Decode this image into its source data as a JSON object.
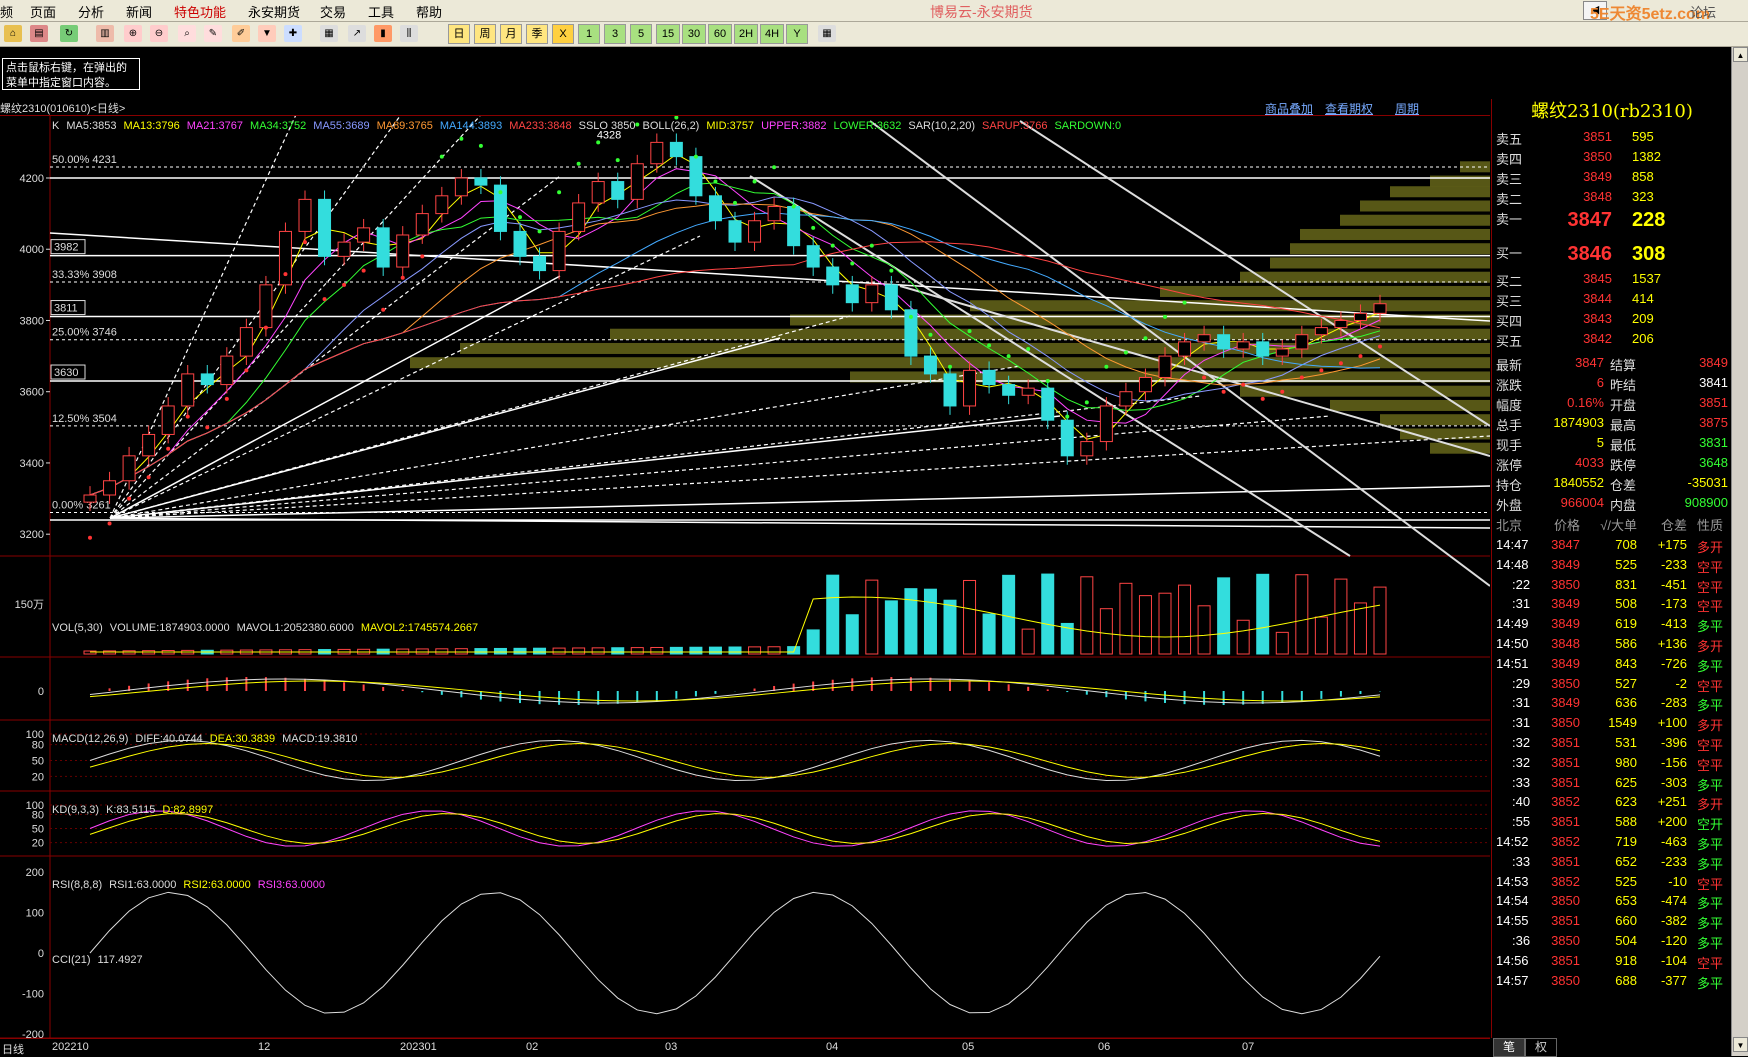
{
  "menu": {
    "items": [
      "频",
      "页面",
      "分析",
      "新闻",
      "特色功能",
      "永安期货",
      "交易",
      "工具",
      "帮助"
    ],
    "title": "博易云-永安期货",
    "watermark": "5E天资5etz.com",
    "forum": "论坛"
  },
  "toolbar": {
    "period_buttons": [
      "日",
      "周",
      "月",
      "季",
      "X",
      "1",
      "3",
      "5",
      "15",
      "30",
      "60",
      "2H",
      "4H",
      "Y"
    ]
  },
  "tip": {
    "line1": "点击鼠标右键，在弹出的",
    "line2": "菜单中指定窗口内容。"
  },
  "chart_header": {
    "instrument": "螺纹2310(010610)<日线>",
    "links": [
      "商品叠加",
      "查看期权",
      "周期"
    ]
  },
  "main_legend": [
    {
      "text": "K",
      "color": "#dddddd"
    },
    {
      "text": "MA5:3853",
      "color": "#dddddd"
    },
    {
      "text": "MA13:3796",
      "color": "#ffff00"
    },
    {
      "text": "MA21:3767",
      "color": "#ff44ff"
    },
    {
      "text": "MA34:3752",
      "color": "#33ff33"
    },
    {
      "text": "MA55:3689",
      "color": "#8899ff"
    },
    {
      "text": "MA89:3765",
      "color": "#ff9933"
    },
    {
      "text": "MA144:3893",
      "color": "#44aaff"
    },
    {
      "text": "MA233:3848",
      "color": "#ff4444"
    },
    {
      "text": "SSLO 3850",
      "color": "#dddddd"
    },
    {
      "text": "BOLL(26,2)",
      "color": "#dddddd"
    },
    {
      "text": "MID:3757",
      "color": "#ffff00"
    },
    {
      "text": "UPPER:3882",
      "color": "#ff44ff"
    },
    {
      "text": "LOWER:3632",
      "color": "#33ff33"
    },
    {
      "text": "SAR(10,2,20)",
      "color": "#dddddd"
    },
    {
      "text": "SARUP:3766",
      "color": "#ff4444"
    },
    {
      "text": "SARDOWN:0",
      "color": "#33ff33"
    }
  ],
  "price_axis": [
    "4200",
    "4000",
    "3800",
    "3600",
    "3400",
    "3200"
  ],
  "fib_labels": [
    "50.00%  4231",
    "33.33%  3908",
    "25.00%  3746",
    "12.50%  3504",
    "0.00%  3261"
  ],
  "boxed_levels": [
    "3982",
    "3811",
    "3630"
  ],
  "peak_label": "4328",
  "vol": {
    "legend": [
      {
        "text": "VOL(5,30)",
        "color": "#dddddd"
      },
      {
        "text": "VOLUME:1874903.0000",
        "color": "#dddddd"
      },
      {
        "text": "MAVOL1:2052380.6000",
        "color": "#dddddd"
      },
      {
        "text": "MAVOL2:1745574.2667",
        "color": "#ffff00"
      }
    ],
    "axis": "150万"
  },
  "macd": {
    "legend": [
      {
        "text": "MACD(12,26,9)",
        "color": "#dddddd"
      },
      {
        "text": "DIFF:40.0744",
        "color": "#dddddd"
      },
      {
        "text": "DEA:30.3839",
        "color": "#ffff00"
      },
      {
        "text": "MACD:19.3810",
        "color": "#dddddd"
      }
    ],
    "axis": "0"
  },
  "kd": {
    "legend": [
      {
        "text": "KD(9,3,3)",
        "color": "#dddddd"
      },
      {
        "text": "K:83.5115",
        "color": "#dddddd"
      },
      {
        "text": "D:82.8997",
        "color": "#ffff00"
      }
    ],
    "axis": [
      "100",
      "80",
      "50",
      "20"
    ]
  },
  "rsi": {
    "legend": [
      {
        "text": "RSI(8,8,8)",
        "color": "#dddddd"
      },
      {
        "text": "RSI1:63.0000",
        "color": "#dddddd"
      },
      {
        "text": "RSI2:63.0000",
        "color": "#ffff00"
      },
      {
        "text": "RSI3:63.0000",
        "color": "#ff44ff"
      }
    ],
    "axis": [
      "100",
      "80",
      "50",
      "20"
    ]
  },
  "cci": {
    "legend": [
      {
        "text": "CCI(21)",
        "color": "#dddddd"
      },
      {
        "text": "117.4927",
        "color": "#dddddd"
      }
    ],
    "axis": [
      "200",
      "100",
      "0",
      "-100",
      "-200"
    ]
  },
  "date_axis": {
    "label": "日线",
    "ticks": [
      "202210",
      "12",
      "202301",
      "02",
      "03",
      "04",
      "05",
      "06",
      "07"
    ]
  },
  "quote": {
    "name": "螺纹2310(rb2310)",
    "asks": [
      {
        "label": "卖五",
        "price": "3851",
        "vol": "595"
      },
      {
        "label": "卖四",
        "price": "3850",
        "vol": "1382"
      },
      {
        "label": "卖三",
        "price": "3849",
        "vol": "858"
      },
      {
        "label": "卖二",
        "price": "3848",
        "vol": "323"
      },
      {
        "label": "卖一",
        "price": "3847",
        "vol": "228"
      }
    ],
    "bids": [
      {
        "label": "买一",
        "price": "3846",
        "vol": "308"
      },
      {
        "label": "买二",
        "price": "3845",
        "vol": "1537"
      },
      {
        "label": "买三",
        "price": "3844",
        "vol": "414"
      },
      {
        "label": "买四",
        "price": "3843",
        "vol": "209"
      },
      {
        "label": "买五",
        "price": "3842",
        "vol": "206"
      }
    ],
    "stats": [
      {
        "k1": "最新",
        "v1": "3847",
        "c1": "#ff3333",
        "k2": "结算",
        "v2": "3849",
        "c2": "#ff3333"
      },
      {
        "k1": "涨跌",
        "v1": "6",
        "c1": "#ff3333",
        "k2": "昨结",
        "v2": "3841",
        "c2": "#ffffff"
      },
      {
        "k1": "幅度",
        "v1": "0.16%",
        "c1": "#ff3333",
        "k2": "开盘",
        "v2": "3851",
        "c2": "#ff3333"
      },
      {
        "k1": "总手",
        "v1": "1874903",
        "c1": "#ffff00",
        "k2": "最高",
        "v2": "3875",
        "c2": "#ff3333"
      },
      {
        "k1": "现手",
        "v1": "5",
        "c1": "#ffff00",
        "k2": "最低",
        "v2": "3831",
        "c2": "#33ff33"
      },
      {
        "k1": "涨停",
        "v1": "4033",
        "c1": "#ff3333",
        "k2": "跌停",
        "v2": "3648",
        "c2": "#33ff33"
      },
      {
        "k1": "持仓",
        "v1": "1840552",
        "c1": "#ffff00",
        "k2": "仓差",
        "v2": "-35031",
        "c2": "#ffff00"
      },
      {
        "k1": "外盘",
        "v1": "966004",
        "c1": "#ff3333",
        "k2": "内盘",
        "v2": "908900",
        "c2": "#33ff33"
      }
    ],
    "tick_header": [
      "北京",
      "价格",
      "√/大单",
      "仓差",
      "性质"
    ],
    "ticks": [
      {
        "t": "14:47",
        "p": "3847",
        "v": "708",
        "d": "+175",
        "n": "多开",
        "nc": "#ff3333"
      },
      {
        "t": "14:48",
        "p": "3849",
        "v": "525",
        "d": "-233",
        "n": "空平",
        "nc": "#ff3333"
      },
      {
        "t": ":22",
        "p": "3850",
        "v": "831",
        "d": "-451",
        "n": "空平",
        "nc": "#ff3333"
      },
      {
        "t": ":31",
        "p": "3849",
        "v": "508",
        "d": "-173",
        "n": "空平",
        "nc": "#ff3333"
      },
      {
        "t": "14:49",
        "p": "3849",
        "v": "619",
        "d": "-413",
        "n": "多平",
        "nc": "#33ff33"
      },
      {
        "t": "14:50",
        "p": "3848",
        "v": "586",
        "d": "+136",
        "n": "多开",
        "nc": "#ff3333"
      },
      {
        "t": "14:51",
        "p": "3849",
        "v": "843",
        "d": "-726",
        "n": "多平",
        "nc": "#33ff33"
      },
      {
        "t": ":29",
        "p": "3850",
        "v": "527",
        "d": "-2",
        "n": "空平",
        "nc": "#ff3333"
      },
      {
        "t": ":31",
        "p": "3849",
        "v": "636",
        "d": "-283",
        "n": "多平",
        "nc": "#33ff33"
      },
      {
        "t": ":31",
        "p": "3850",
        "v": "1549",
        "d": "+100",
        "n": "多开",
        "nc": "#ff3333"
      },
      {
        "t": ":32",
        "p": "3851",
        "v": "531",
        "d": "-396",
        "n": "空平",
        "nc": "#ff3333"
      },
      {
        "t": ":32",
        "p": "3851",
        "v": "980",
        "d": "-156",
        "n": "空平",
        "nc": "#ff3333"
      },
      {
        "t": ":33",
        "p": "3851",
        "v": "625",
        "d": "-303",
        "n": "多平",
        "nc": "#33ff33"
      },
      {
        "t": ":40",
        "p": "3852",
        "v": "623",
        "d": "+251",
        "n": "多开",
        "nc": "#ff3333"
      },
      {
        "t": ":55",
        "p": "3851",
        "v": "588",
        "d": "+200",
        "n": "空开",
        "nc": "#33ff33"
      },
      {
        "t": "14:52",
        "p": "3852",
        "v": "719",
        "d": "-463",
        "n": "多平",
        "nc": "#33ff33"
      },
      {
        "t": ":33",
        "p": "3851",
        "v": "652",
        "d": "-233",
        "n": "多平",
        "nc": "#33ff33"
      },
      {
        "t": "14:53",
        "p": "3852",
        "v": "525",
        "d": "-10",
        "n": "空平",
        "nc": "#ff3333"
      },
      {
        "t": "14:54",
        "p": "3850",
        "v": "653",
        "d": "-474",
        "n": "多平",
        "nc": "#33ff33"
      },
      {
        "t": "14:55",
        "p": "3851",
        "v": "660",
        "d": "-382",
        "n": "多平",
        "nc": "#33ff33"
      },
      {
        "t": ":36",
        "p": "3850",
        "v": "504",
        "d": "-120",
        "n": "多平",
        "nc": "#33ff33"
      },
      {
        "t": "14:56",
        "p": "3851",
        "v": "918",
        "d": "-104",
        "n": "空平",
        "nc": "#ff3333"
      },
      {
        "t": "14:57",
        "p": "3850",
        "v": "688",
        "d": "-377",
        "n": "多平",
        "nc": "#33ff33"
      }
    ],
    "tabs": [
      "笔",
      "权"
    ]
  },
  "chart_data": {
    "type": "candlestick",
    "title": "螺纹2310(010610)<日线>",
    "ylim": [
      3150,
      4360
    ],
    "x_ticks": [
      "202210",
      "12",
      "202301",
      "02",
      "03",
      "04",
      "05",
      "06",
      "07"
    ],
    "close_path": [
      3310,
      3350,
      3420,
      3480,
      3560,
      3650,
      3620,
      3700,
      3780,
      3900,
      4050,
      4140,
      3980,
      4020,
      4060,
      3950,
      4040,
      4100,
      4150,
      4200,
      4180,
      4050,
      3980,
      3940,
      4050,
      4130,
      4190,
      4140,
      4240,
      4300,
      4260,
      4150,
      4080,
      4020,
      4080,
      4120,
      4010,
      3950,
      3900,
      3850,
      3900,
      3830,
      3700,
      3650,
      3560,
      3660,
      3620,
      3590,
      3610,
      3520,
      3420,
      3460,
      3560,
      3600,
      3640,
      3700,
      3740,
      3760,
      3720,
      3740,
      3700,
      3720,
      3760,
      3780,
      3800,
      3820,
      3847
    ],
    "last_price": 3847
  }
}
